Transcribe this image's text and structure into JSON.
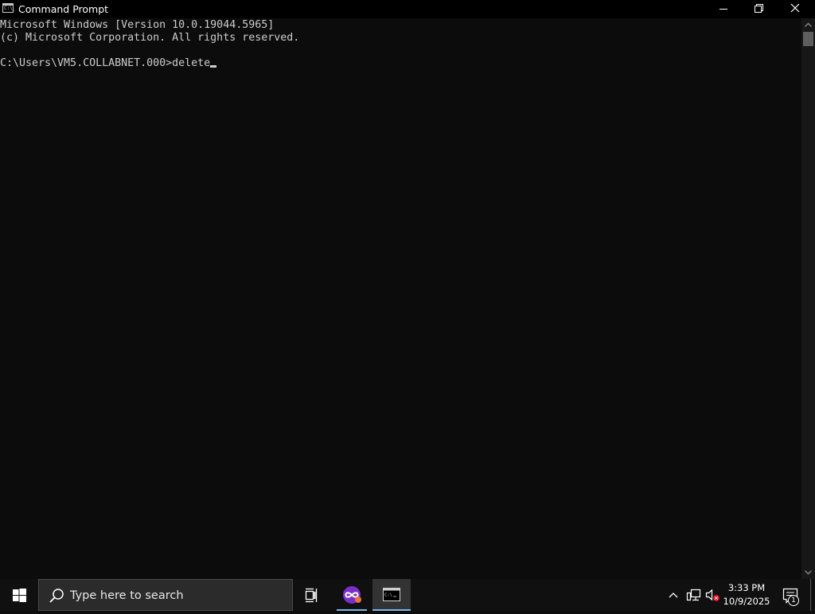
{
  "window": {
    "title": "Command Prompt",
    "icon": "cmd-icon",
    "icon_text": "C:\\_"
  },
  "console": {
    "lines": [
      "Microsoft Windows [Version 10.0.19044.5965]",
      "(c) Microsoft Corporation. All rights reserved.",
      "",
      "C:\\Users\\VM5.COLLABNET.000>delete"
    ],
    "text_color": "#cccccc",
    "background": "#0c0c0c"
  },
  "taskbar": {
    "search_placeholder": "Type here to search",
    "apps": [
      {
        "name": "cortana-app",
        "icon": "infinity-mask-icon"
      },
      {
        "name": "command-prompt",
        "icon": "cmd-icon",
        "active": true
      }
    ],
    "clock": {
      "time": "3:33 PM",
      "date": "10/9/2025"
    },
    "notification_count": "1",
    "accent": "#76b9ed"
  }
}
